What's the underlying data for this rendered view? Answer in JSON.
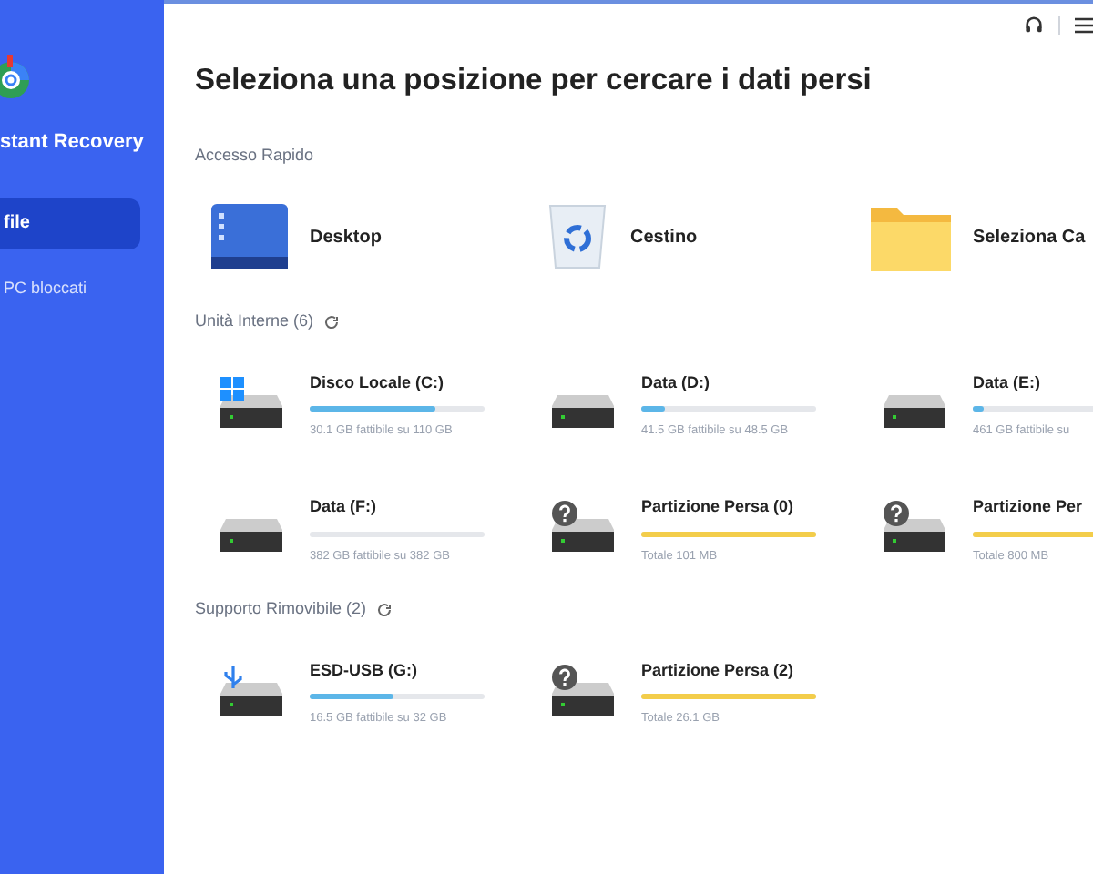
{
  "sidebar": {
    "app_name": "stant Recovery",
    "items": [
      {
        "label": "file",
        "selected": true
      },
      {
        "label": "PC bloccati",
        "selected": false
      }
    ]
  },
  "title": "Seleziona una posizione per cercare i dati persi",
  "quick_access": {
    "heading": "Accesso Rapido",
    "items": [
      {
        "kind": "desktop",
        "label": "Desktop"
      },
      {
        "kind": "bin",
        "label": "Cestino"
      },
      {
        "kind": "folder",
        "label": "Seleziona Ca"
      }
    ]
  },
  "sections": [
    {
      "heading": "Unità Interne (6)",
      "drives": [
        {
          "kind": "windows",
          "name": "Disco Locale (C:)",
          "level": 0.72,
          "info": "30.1 GB fattibile su 110 GB"
        },
        {
          "kind": "disk",
          "name": "Data (D:)",
          "level": 0.14,
          "info": "41.5 GB fattibile su 48.5 GB"
        },
        {
          "kind": "disk",
          "name": "Data (E:)",
          "level": 0.06,
          "info": "461 GB fattibile su"
        },
        {
          "kind": "disk",
          "name": "Data (F:)",
          "level": 0,
          "info": "382 GB fattibile su 382 GB"
        },
        {
          "kind": "lost",
          "name": "Partizione Persa (0)",
          "level": 1,
          "info": "Totale 101 MB"
        },
        {
          "kind": "lost",
          "name": "Partizione Per",
          "level": 1,
          "info": "Totale 800 MB"
        }
      ]
    },
    {
      "heading": "Supporto Rimovibile (2)",
      "drives": [
        {
          "kind": "usb",
          "name": "ESD-USB (G:)",
          "level": 0.48,
          "info": "16.5 GB fattibile su 32 GB"
        },
        {
          "kind": "lost",
          "name": "Partizione Persa (2)",
          "level": 1,
          "info": "Totale 26.1 GB"
        }
      ]
    }
  ]
}
